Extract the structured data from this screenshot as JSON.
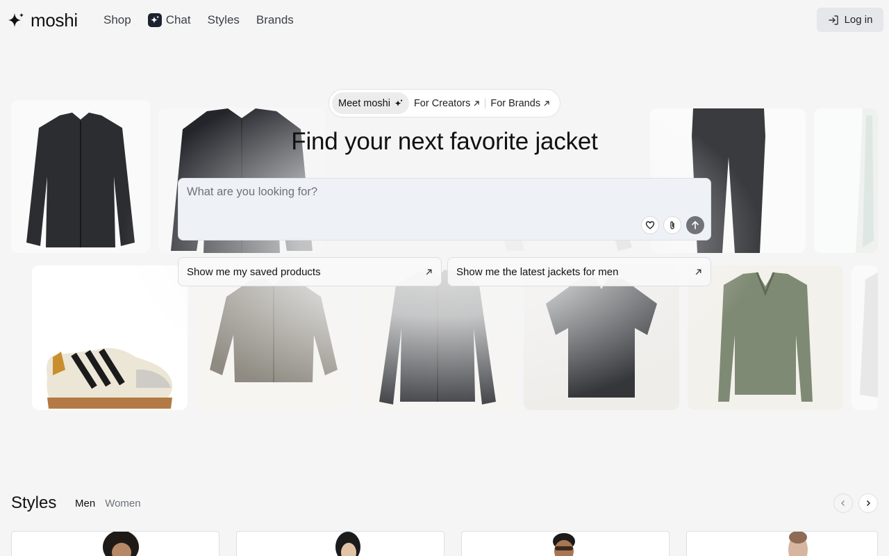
{
  "header": {
    "logo_text": "moshi",
    "nav": [
      {
        "label": "Shop"
      },
      {
        "label": "Chat",
        "icon": "sparkle-icon"
      },
      {
        "label": "Styles"
      },
      {
        "label": "Brands"
      }
    ],
    "login_label": "Log in",
    "login_icon": "login-icon"
  },
  "hero": {
    "pills": {
      "meet": "Meet moshi",
      "creators": "For Creators",
      "brands": "For Brands"
    },
    "title": "Find your next favorite jacket",
    "search": {
      "placeholder": "What are you looking for?"
    },
    "suggestions": [
      {
        "text": "Show me my saved products"
      },
      {
        "text": "Show me the latest jackets for men"
      }
    ],
    "product_tiles": [
      {
        "kind": "jacket-zip",
        "color": "#2b2d31"
      },
      {
        "kind": "jacket-shirt",
        "color": "#23252b"
      },
      {
        "kind": "jacket-center",
        "color": "#d9d9d9"
      },
      {
        "kind": "trousers",
        "color": "#3a3b3f"
      },
      {
        "kind": "cream-item",
        "color": "#f2f3ef"
      },
      {
        "kind": "sneaker",
        "color": "#e9e4d6"
      },
      {
        "kind": "bomber-jacket",
        "color": "#8f8b82"
      },
      {
        "kind": "overshirt",
        "color": "#3a3c40"
      },
      {
        "kind": "polo-shirt",
        "color": "#34363a"
      },
      {
        "kind": "knit-polo",
        "color": "#7f8a74"
      }
    ]
  },
  "styles": {
    "title": "Styles",
    "tabs": [
      {
        "label": "Men",
        "active": true
      },
      {
        "label": "Women",
        "active": false
      }
    ]
  },
  "colors": {
    "background": "#f5f5f5",
    "search_bg": "#eef1f5",
    "send_button": "#707378",
    "chat_badge": "#1c2230"
  }
}
